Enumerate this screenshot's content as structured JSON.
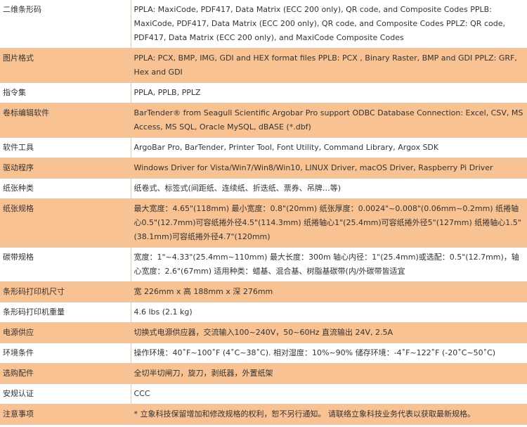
{
  "rows": [
    {
      "label": "二维条形码",
      "value": "PPLA: MaxiCode, PDF417, Data Matrix (ECC 200 only), QR code, and Composite Codes PPLB: MaxiCode, PDF417, Data Matrix (ECC 200 only), QR code, and Composite Codes PPLZ: QR code, PDF417, Data Matrix (ECC 200 only), and MaxiCode Composite Codes"
    },
    {
      "label": "图片格式",
      "value": "PPLA: PCX, BMP, IMG, GDI and HEX format files PPLB: PCX , Binary Raster, BMP and GDI PPLZ: GRF, Hex and GDI"
    },
    {
      "label": "指令集",
      "value": "PPLA, PPLB, PPLZ"
    },
    {
      "label": "卷标编辑软件",
      "value": "BarTender® from Seagull Scientific Argobar Pro support ODBC Database Connection: Excel, CSV, MS Access, MS SQL, Oracle MySQL, dBASE (*.dbf)"
    },
    {
      "label": "软件工具",
      "value": "ArgoBar Pro, BarTender, Printer Tool, Font Utility, Command Library, Argox SDK"
    },
    {
      "label": "驱动程序",
      "value": "Windows Driver for Vista/Win7/Win8/Win10, LINUX Driver, macOS Driver, Raspberry Pi Driver"
    },
    {
      "label": "纸张种类",
      "value": "纸卷式、标签式(间距纸、连续纸、折迭纸、票券、吊牌…等)"
    },
    {
      "label": "纸张规格",
      "value": "最大宽度：4.65\"(118mm) 最小宽度：0.8\"(20mm) 纸张厚度：0.0024\"~0.008\"(0.06mm~0.2mm) 纸捲轴心0.5\"(12.7mm)可容纸捲外径4.5\"(114.3mm) 纸捲轴心1\"(25.4mm)可容纸捲外径5\"(127mm) 纸捲轴心1.5\"(38.1mm)可容纸捲外径4.7\"(120mm)"
    },
    {
      "label": "碳带规格",
      "value": "宽度：1\"~4.33\"(25.4mm~110mm) 最大长度：300m 轴心内径：1\"(25.4mm)或选配：0.5\"(12.7mm)，轴心宽度：2.6\"(67mm) 适用种类：蜡基、混合基、树脂基碳带(内/外碳带皆适宜"
    },
    {
      "label": "条形码打印机尺寸",
      "value": "宽 226mm x 高 188mm x 深 276mm"
    },
    {
      "label": "条形码打印机重量",
      "value": "4.6 lbs (2.1 kg)"
    },
    {
      "label": "电源供应",
      "value": "切换式电源供应器，交流输入100~240V，50~60Hz 直流输出 24V, 2.5A"
    },
    {
      "label": "环境条件",
      "value": "操作环境：40˚F~100˚F (4˚C~38˚C). 相对湿度：10%~90% 储存环境：-4˚F~122˚F (-20˚C~50˚C)"
    },
    {
      "label": "选购配件",
      "value": "全切半切闸刀，旋刀，剥纸器，外置纸架"
    },
    {
      "label": "安规认证",
      "value": "CCC"
    },
    {
      "label": "注意事项",
      "value": "* 立象科技保留增加和修改规格的权利，恕不另行通知。 请联络立象科技业务代表以获取最新规格。"
    }
  ]
}
